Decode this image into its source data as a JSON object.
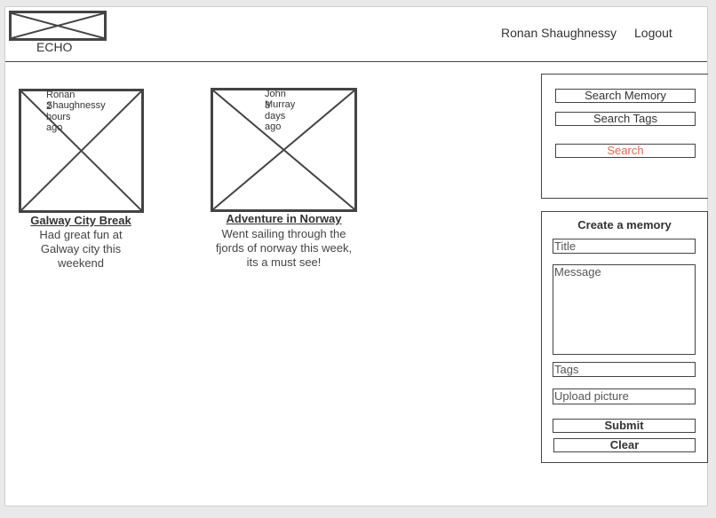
{
  "header": {
    "logo_text": "ECHO",
    "user_name": "Ronan Shaughnessy",
    "logout_label": "Logout"
  },
  "feed": [
    {
      "author": "Ronan Shaughnessy",
      "time": "2 hours ago",
      "title": "Galway City Break",
      "description": "Had great fun at Galway city this weekend"
    },
    {
      "author": "John Murray",
      "time": "3 days ago",
      "title": "Adventure in Norway",
      "description": "Went sailing through the fjords of norway this week, its a must see!"
    }
  ],
  "search": {
    "memory_label": "Search Memory",
    "tags_label": "Search Tags",
    "search_label": "Search",
    "search_color": "#e8674d"
  },
  "create": {
    "heading": "Create a memory",
    "title_placeholder": "Title",
    "message_placeholder": "Message",
    "tags_placeholder": "Tags",
    "upload_label": "Upload picture",
    "submit_label": "Submit",
    "clear_label": "Clear"
  }
}
